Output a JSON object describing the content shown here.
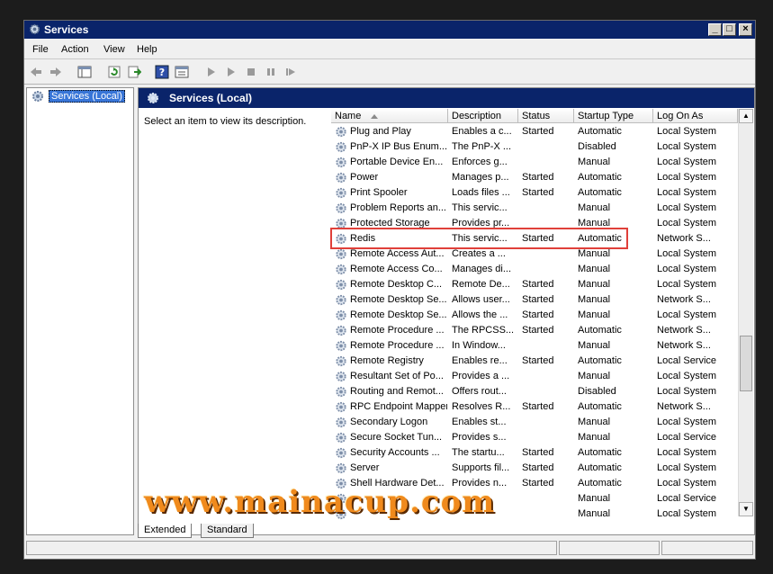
{
  "window": {
    "title": "Services"
  },
  "menu": [
    "File",
    "Action",
    "View",
    "Help"
  ],
  "tree": {
    "root_label": "Services (Local)"
  },
  "panel": {
    "header": "Services (Local)",
    "description": "Select an item to view its description."
  },
  "columns": [
    "Name",
    "Description",
    "Status",
    "Startup Type",
    "Log On As"
  ],
  "services": [
    [
      "Plug and Play",
      "Enables a c...",
      "Started",
      "Automatic",
      "Local System"
    ],
    [
      "PnP-X IP Bus Enum...",
      "The PnP-X ...",
      "",
      "Disabled",
      "Local System"
    ],
    [
      "Portable Device En...",
      "Enforces g...",
      "",
      "Manual",
      "Local System"
    ],
    [
      "Power",
      "Manages p...",
      "Started",
      "Automatic",
      "Local System"
    ],
    [
      "Print Spooler",
      "Loads files ...",
      "Started",
      "Automatic",
      "Local System"
    ],
    [
      "Problem Reports an...",
      "This servic...",
      "",
      "Manual",
      "Local System"
    ],
    [
      "Protected Storage",
      "Provides pr...",
      "",
      "Manual",
      "Local System"
    ],
    [
      "Redis",
      "This servic...",
      "Started",
      "Automatic",
      "Network S..."
    ],
    [
      "Remote Access Aut...",
      "Creates a ...",
      "",
      "Manual",
      "Local System"
    ],
    [
      "Remote Access Co...",
      "Manages di...",
      "",
      "Manual",
      "Local System"
    ],
    [
      "Remote Desktop C...",
      "Remote De...",
      "Started",
      "Manual",
      "Local System"
    ],
    [
      "Remote Desktop Se...",
      "Allows user...",
      "Started",
      "Manual",
      "Network S..."
    ],
    [
      "Remote Desktop Se...",
      "Allows the ...",
      "Started",
      "Manual",
      "Local System"
    ],
    [
      "Remote Procedure ...",
      "The RPCSS...",
      "Started",
      "Automatic",
      "Network S..."
    ],
    [
      "Remote Procedure ...",
      "In Window...",
      "",
      "Manual",
      "Network S..."
    ],
    [
      "Remote Registry",
      "Enables re...",
      "Started",
      "Automatic",
      "Local Service"
    ],
    [
      "Resultant Set of Po...",
      "Provides a ...",
      "",
      "Manual",
      "Local System"
    ],
    [
      "Routing and Remot...",
      "Offers rout...",
      "",
      "Disabled",
      "Local System"
    ],
    [
      "RPC Endpoint Mapper",
      "Resolves R...",
      "Started",
      "Automatic",
      "Network S..."
    ],
    [
      "Secondary Logon",
      "Enables st...",
      "",
      "Manual",
      "Local System"
    ],
    [
      "Secure Socket Tun...",
      "Provides s...",
      "",
      "Manual",
      "Local Service"
    ],
    [
      "Security Accounts ...",
      "The startu...",
      "Started",
      "Automatic",
      "Local System"
    ],
    [
      "Server",
      "Supports fil...",
      "Started",
      "Automatic",
      "Local System"
    ],
    [
      "Shell Hardware Det...",
      "Provides n...",
      "Started",
      "Automatic",
      "Local System"
    ],
    [
      "",
      "",
      "",
      "Manual",
      "Local Service"
    ],
    [
      "",
      "",
      "",
      "Manual",
      "Local System"
    ]
  ],
  "tabs": [
    "Extended",
    "Standard"
  ],
  "watermark": "www.mainacup.com",
  "colors": {
    "titlebar": "#0a246a",
    "selection": "#3875d7",
    "highlight_box": "#e0403a",
    "watermark": "#f08a1c"
  }
}
